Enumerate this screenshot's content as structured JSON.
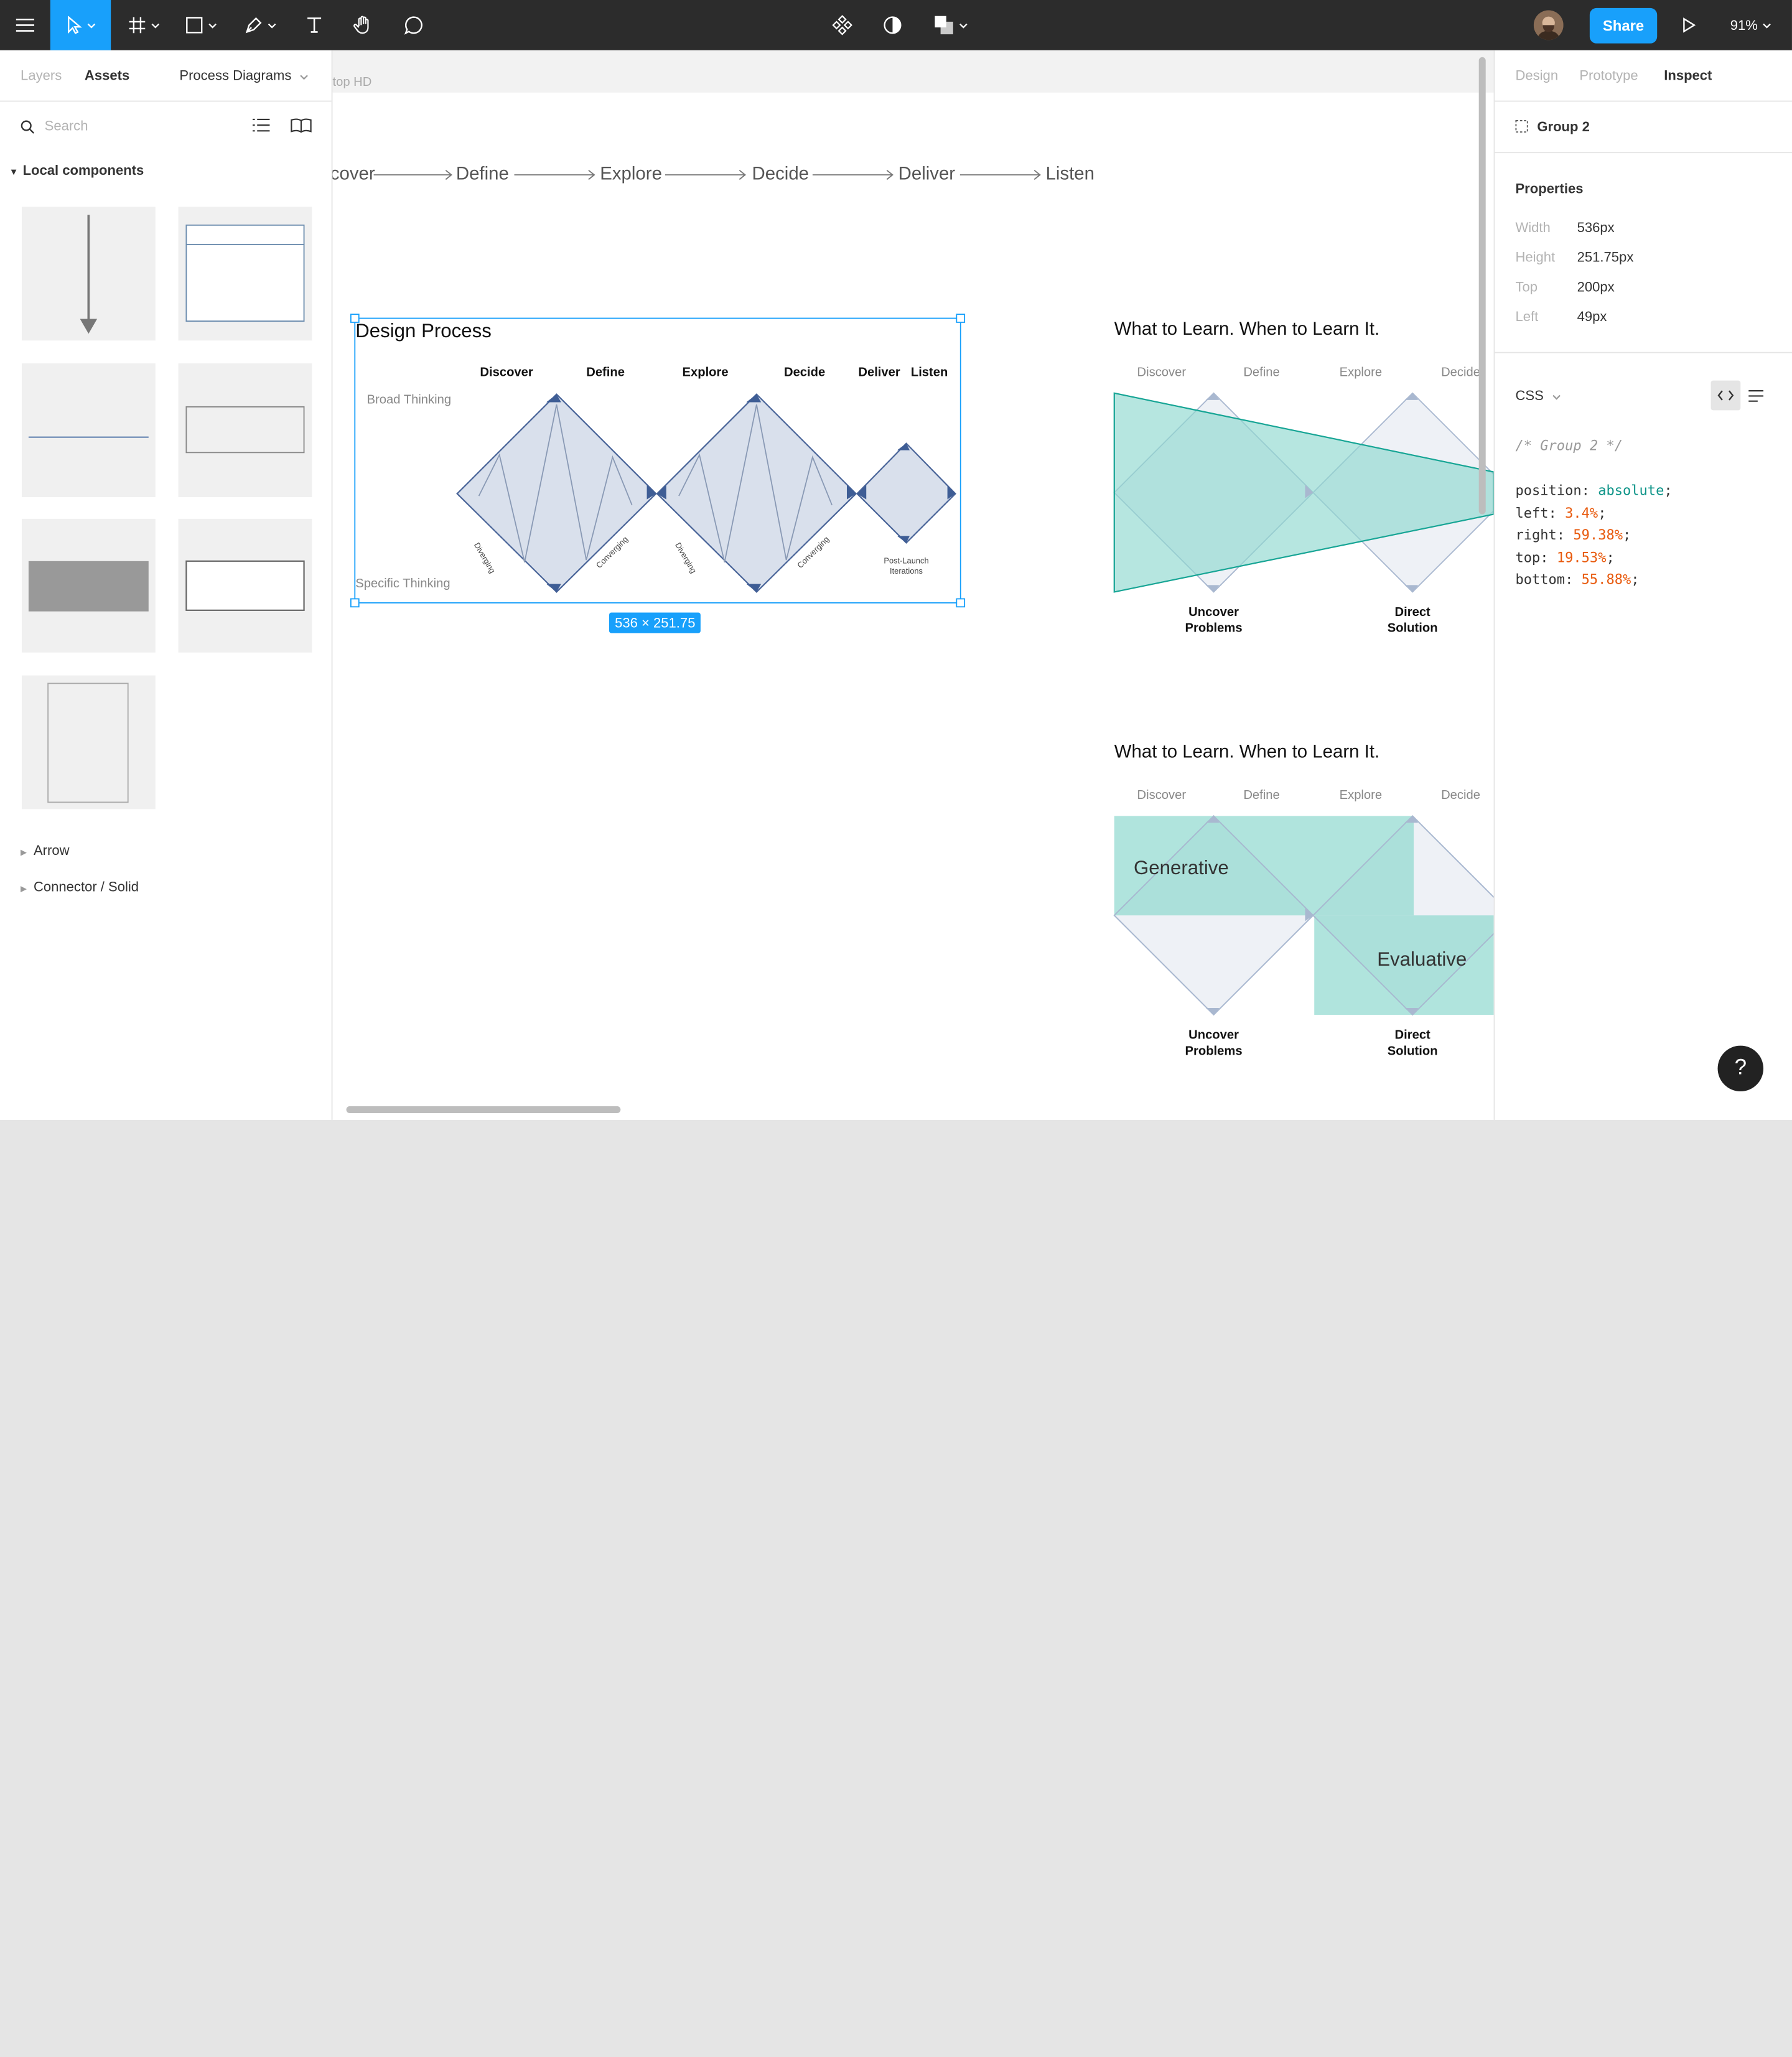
{
  "toolbar": {
    "share_label": "Share",
    "zoom": "91%"
  },
  "left_panel": {
    "tabs": [
      "Layers",
      "Assets"
    ],
    "page_selector": "Process Diagrams",
    "search_placeholder": "Search",
    "section_title": "Local components",
    "tree_items": [
      "Arrow",
      "Connector / Solid"
    ]
  },
  "canvas": {
    "frame_label": "top HD",
    "flow_steps": [
      "cover",
      "Define",
      "Explore",
      "Decide",
      "Deliver",
      "Listen"
    ],
    "design_process": {
      "title": "Design Process",
      "stages": [
        "Discover",
        "Define",
        "Explore",
        "Decide",
        "Deliver",
        "Listen"
      ],
      "broad": "Broad Thinking",
      "specific": "Specific Thinking",
      "diverging": "Diverging",
      "converging": "Converging",
      "post_launch": "Post-Launch Iterations",
      "size_badge": "536 × 251.75"
    },
    "learn_1": {
      "title": "What to Learn. When to Learn It.",
      "stages": [
        "Discover",
        "Define",
        "Explore",
        "Decide"
      ],
      "bottom_1": "Uncover Problems",
      "bottom_2": "Direct Solution"
    },
    "learn_2": {
      "title": "What to Learn. When to Learn It.",
      "stages": [
        "Discover",
        "Define",
        "Explore",
        "Decide"
      ],
      "generative": "Generative",
      "evaluative": "Evaluative",
      "bottom_1": "Uncover Problems",
      "bottom_2": "Direct Solution"
    }
  },
  "right_panel": {
    "tabs": [
      "Design",
      "Prototype",
      "Inspect"
    ],
    "selection": "Group 2",
    "properties_title": "Properties",
    "props": [
      {
        "k": "Width",
        "v": "536px"
      },
      {
        "k": "Height",
        "v": "251.75px"
      },
      {
        "k": "Top",
        "v": "200px"
      },
      {
        "k": "Left",
        "v": "49px"
      }
    ],
    "code_lang": "CSS",
    "code_comment": "/* Group 2 */",
    "code": [
      {
        "p": "position:",
        "v": "absolute",
        "c": "#0d9488"
      },
      {
        "p": "left:",
        "v": "3.4%",
        "c": "#e8590c"
      },
      {
        "p": "right:",
        "v": "59.38%",
        "c": "#e8590c"
      },
      {
        "p": "top:",
        "v": "19.53%",
        "c": "#e8590c"
      },
      {
        "p": "bottom:",
        "v": "55.88%",
        "c": "#e8590c"
      }
    ]
  },
  "help_label": "?"
}
